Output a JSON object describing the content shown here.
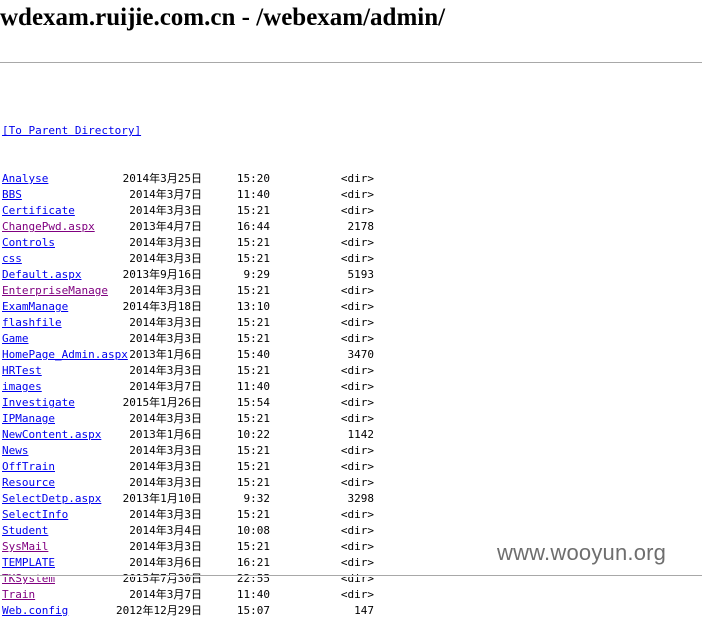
{
  "page": {
    "title": "wdexam.ruijie.com.cn - /webexam/admin/",
    "parent_link": "[To Parent Directory]"
  },
  "entries": [
    {
      "date": "2014年3月25日",
      "time": "15:20",
      "size": "<dir>",
      "name": "Analyse",
      "visited": false
    },
    {
      "date": "2014年3月7日",
      "time": "11:40",
      "size": "<dir>",
      "name": "BBS",
      "visited": false
    },
    {
      "date": "2014年3月3日",
      "time": "15:21",
      "size": "<dir>",
      "name": "Certificate",
      "visited": false
    },
    {
      "date": "2013年4月7日",
      "time": "16:44",
      "size": "2178",
      "name": "ChangePwd.aspx",
      "visited": true
    },
    {
      "date": "2014年3月3日",
      "time": "15:21",
      "size": "<dir>",
      "name": "Controls",
      "visited": false
    },
    {
      "date": "2014年3月3日",
      "time": "15:21",
      "size": "<dir>",
      "name": "css",
      "visited": false
    },
    {
      "date": "2013年9月16日",
      "time": "9:29",
      "size": "5193",
      "name": "Default.aspx",
      "visited": false
    },
    {
      "date": "2014年3月3日",
      "time": "15:21",
      "size": "<dir>",
      "name": "EnterpriseManage",
      "visited": true
    },
    {
      "date": "2014年3月18日",
      "time": "13:10",
      "size": "<dir>",
      "name": "ExamManage",
      "visited": false
    },
    {
      "date": "2014年3月3日",
      "time": "15:21",
      "size": "<dir>",
      "name": "flashfile",
      "visited": false
    },
    {
      "date": "2014年3月3日",
      "time": "15:21",
      "size": "<dir>",
      "name": "Game",
      "visited": false
    },
    {
      "date": "2013年1月6日",
      "time": "15:40",
      "size": "3470",
      "name": "HomePage_Admin.aspx",
      "visited": false
    },
    {
      "date": "2014年3月3日",
      "time": "15:21",
      "size": "<dir>",
      "name": "HRTest",
      "visited": false
    },
    {
      "date": "2014年3月7日",
      "time": "11:40",
      "size": "<dir>",
      "name": "images",
      "visited": false
    },
    {
      "date": "2015年1月26日",
      "time": "15:54",
      "size": "<dir>",
      "name": "Investigate",
      "visited": false
    },
    {
      "date": "2014年3月3日",
      "time": "15:21",
      "size": "<dir>",
      "name": "IPManage",
      "visited": false
    },
    {
      "date": "2013年1月6日",
      "time": "10:22",
      "size": "1142",
      "name": "NewContent.aspx",
      "visited": false
    },
    {
      "date": "2014年3月3日",
      "time": "15:21",
      "size": "<dir>",
      "name": "News",
      "visited": false
    },
    {
      "date": "2014年3月3日",
      "time": "15:21",
      "size": "<dir>",
      "name": "OffTrain",
      "visited": false
    },
    {
      "date": "2014年3月3日",
      "time": "15:21",
      "size": "<dir>",
      "name": "Resource",
      "visited": false
    },
    {
      "date": "2013年1月10日",
      "time": "9:32",
      "size": "3298",
      "name": "SelectDetp.aspx",
      "visited": false
    },
    {
      "date": "2014年3月3日",
      "time": "15:21",
      "size": "<dir>",
      "name": "SelectInfo",
      "visited": false
    },
    {
      "date": "2014年3月4日",
      "time": "10:08",
      "size": "<dir>",
      "name": "Student",
      "visited": false
    },
    {
      "date": "2014年3月3日",
      "time": "15:21",
      "size": "<dir>",
      "name": "SysMail",
      "visited": true
    },
    {
      "date": "2014年3月6日",
      "time": "16:21",
      "size": "<dir>",
      "name": "TEMPLATE",
      "visited": false
    },
    {
      "date": "2015年7月30日",
      "time": "22:55",
      "size": "<dir>",
      "name": "TKSystem",
      "visited": true
    },
    {
      "date": "2014年3月7日",
      "time": "11:40",
      "size": "<dir>",
      "name": "Train",
      "visited": true
    },
    {
      "date": "2012年12月29日",
      "time": "15:07",
      "size": "147",
      "name": "Web.config",
      "visited": false
    }
  ],
  "watermark": "www.wooyun.org"
}
